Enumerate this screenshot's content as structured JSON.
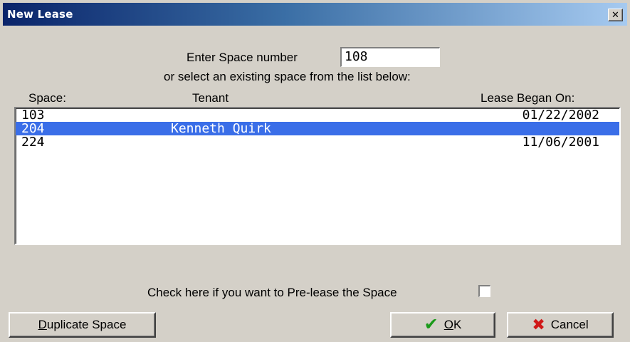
{
  "window": {
    "title": "New Lease",
    "close_glyph": "✕"
  },
  "prompt": {
    "enter_label": "Enter Space number",
    "space_value": "108",
    "select_hint": "or select an existing space from the list below:"
  },
  "list": {
    "headers": {
      "space": "Space:",
      "tenant": "Tenant",
      "lease_began": "Lease Began On:"
    },
    "rows": [
      {
        "space": "103",
        "tenant": "",
        "date": "01/22/2002",
        "selected": false
      },
      {
        "space": "204",
        "tenant": "Kenneth Quirk",
        "date": "",
        "selected": true
      },
      {
        "space": "224",
        "tenant": "",
        "date": "11/06/2001",
        "selected": false
      }
    ]
  },
  "prelease": {
    "label": "Check here if you want to Pre-lease the Space",
    "checked": false
  },
  "buttons": {
    "duplicate_mnemonic": "D",
    "duplicate_rest": "uplicate Space",
    "ok_mnemonic": "O",
    "ok_rest": "K",
    "cancel_label": "Cancel"
  },
  "icons": {
    "ok": "check-icon",
    "cancel": "x-icon"
  },
  "colors": {
    "titlebar_start": "#0a246a",
    "titlebar_end": "#a6caf0",
    "selection": "#3a6ee8",
    "ok_check": "#1a9a1a",
    "cancel_x": "#d01818"
  }
}
